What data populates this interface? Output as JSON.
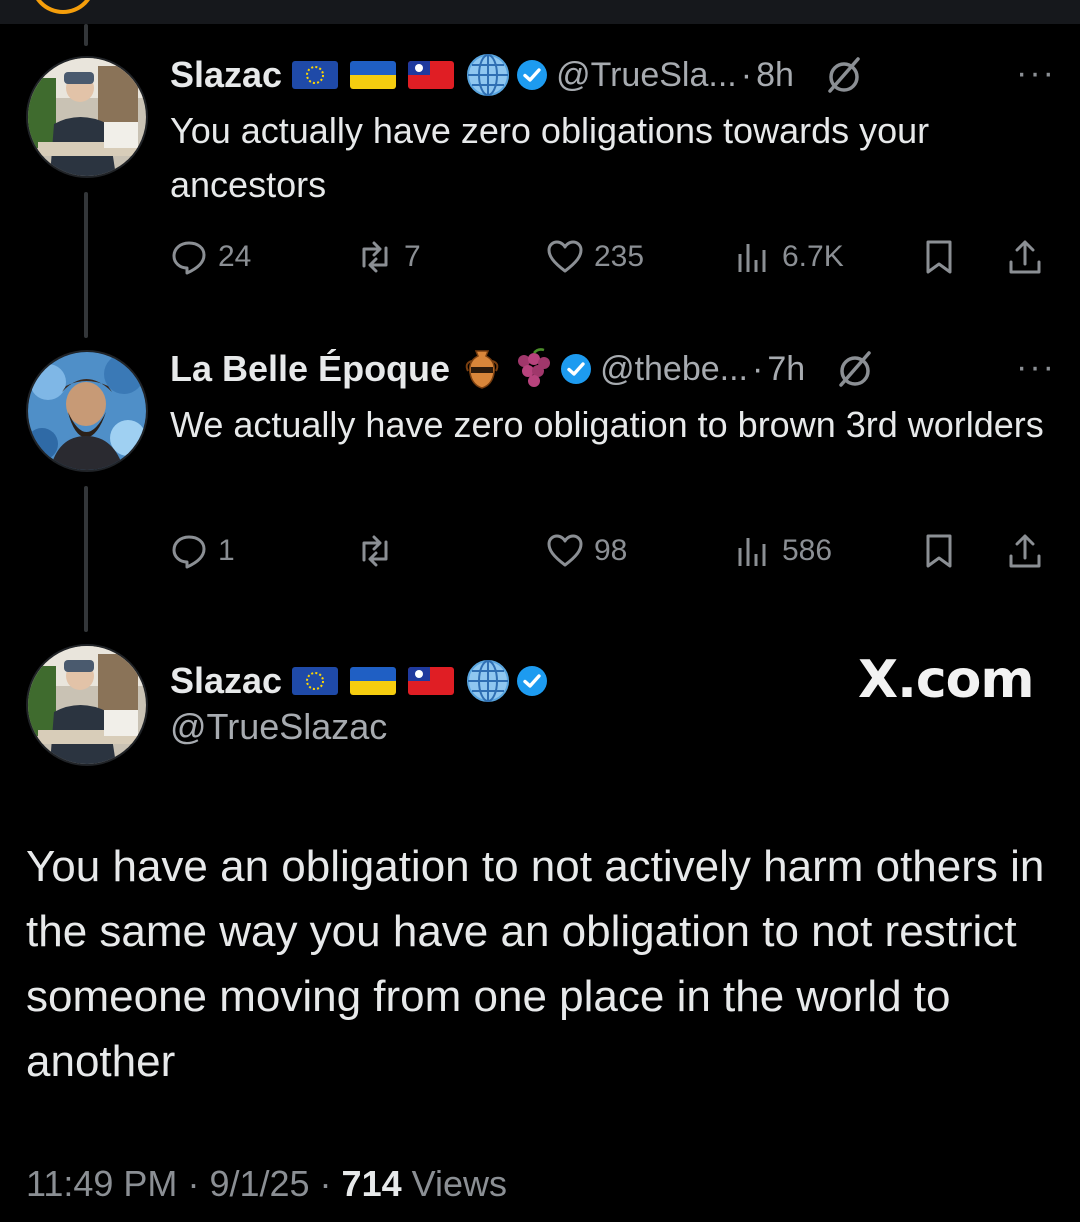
{
  "colors": {
    "background": "#000000",
    "text": "#e7e9ea",
    "muted": "#8b8f94",
    "verified": "#1d9bf0",
    "thread_line": "#333639"
  },
  "tweets": [
    {
      "name": "Slazac",
      "handle": "@TrueSla...",
      "time": "8h",
      "text": "You actually have zero obligations towards your ancestors",
      "replies": "24",
      "reposts": "7",
      "likes": "235",
      "views": "6.7K"
    },
    {
      "name": "La Belle Époque",
      "handle": "@thebe...",
      "time": "7h",
      "text": "We actually have zero obligation to brown 3rd worlders",
      "replies": "1",
      "reposts": "",
      "likes": "98",
      "views": "586"
    }
  ],
  "main_tweet": {
    "name": "Slazac",
    "handle": "@TrueSlazac",
    "watermark": "X.com",
    "text": "You have an obligation to not actively harm others in the same way you have an obligation to not restrict someone moving from one place in the world to another",
    "time": "11:49 PM",
    "date": "9/1/25",
    "views_count": "714",
    "views_label": "Views"
  },
  "icons": [
    "eu-flag-icon",
    "ukraine-flag-icon",
    "taiwan-flag-icon",
    "globe-icon",
    "verified-badge-icon",
    "grok-icon",
    "more-icon",
    "reply-icon",
    "repost-icon",
    "like-icon",
    "views-icon",
    "bookmark-icon",
    "share-icon",
    "amphora-icon",
    "grapes-icon"
  ]
}
